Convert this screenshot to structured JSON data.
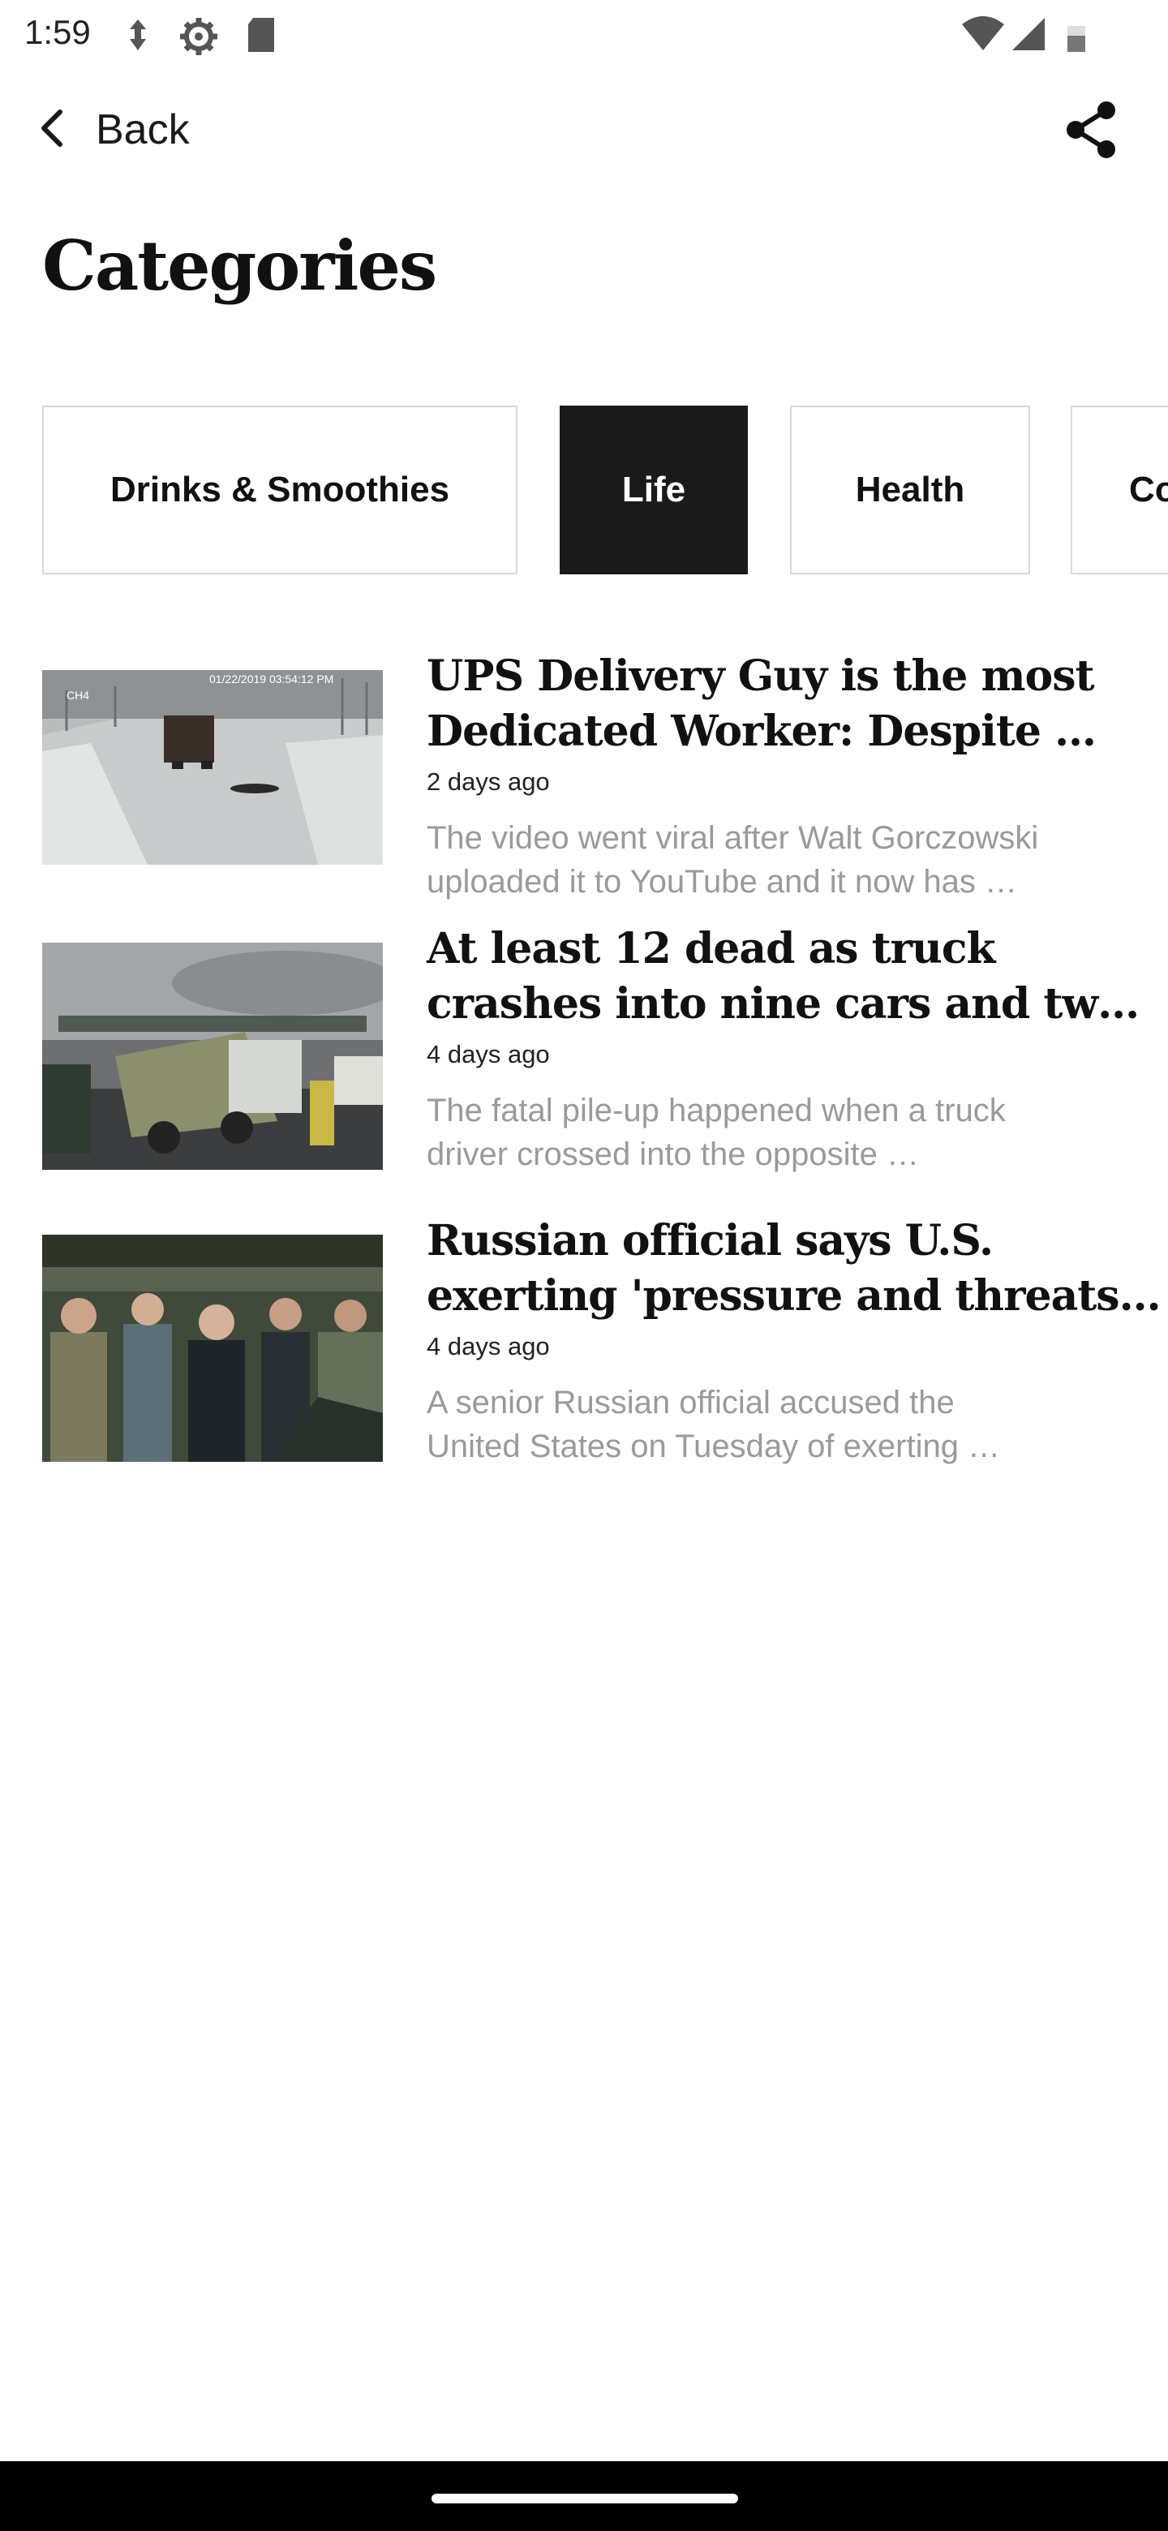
{
  "status_bar": {
    "time": "1:59",
    "icons": [
      "vpn-key-icon",
      "settings-gear-icon",
      "sd-card-icon",
      "wifi-icon",
      "signal-icon",
      "battery-icon"
    ]
  },
  "top_bar": {
    "back_label": "Back",
    "back_icon": "chevron-left-icon",
    "share_icon": "share-icon"
  },
  "page_title": "Categories",
  "categories": [
    {
      "label": "Drinks & Smoothies",
      "active": false
    },
    {
      "label": "Life",
      "active": true
    },
    {
      "label": "Health",
      "active": false
    },
    {
      "label": "Co",
      "active": false
    }
  ],
  "articles": [
    {
      "title": "UPS Delivery Guy is the most\nDedicated Worker: Despite …",
      "time": "2 days ago",
      "description": "The video went viral after Walt Gorczowski\nuploaded it to YouTube and it now has …",
      "thumb_caption": "01/22/2019 03:54:12 PM",
      "thumb_label": "CH4"
    },
    {
      "title": "At least 12 dead as truck\ncrashes into nine cars and tw…",
      "time": "4 days ago",
      "description": "The fatal pile-up happened when a truck\ndriver crossed into the opposite …"
    },
    {
      "title": "Russian official says U.S.\nexerting 'pressure and threats…",
      "time": "4 days ago",
      "description": "A senior Russian official accused the\nUnited States on Tuesday of exerting …"
    }
  ],
  "colors": {
    "accent": "#1a1a1a",
    "chip_border": "#d9d9d9",
    "muted_text": "#9a9a9a"
  }
}
